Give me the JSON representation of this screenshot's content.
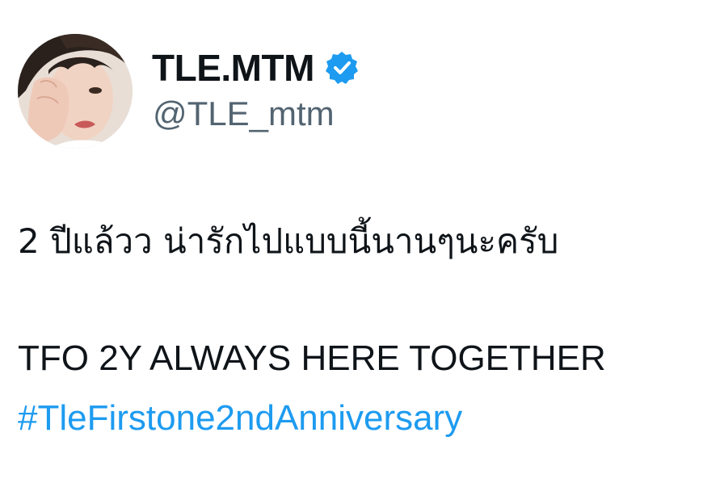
{
  "profile": {
    "display_name": "TLE.MTM",
    "handle": "@TLE_mtm",
    "verified_icon": "verified-badge-icon",
    "avatar_icon": "profile-photo"
  },
  "tweet": {
    "line1": "2 ปีแล้วว น่ารักไปแบบนี้นานๆนะครับ",
    "line2": "TFO 2Y ALWAYS HERE TOGETHER",
    "hashtag": "#TleFirstone2ndAnniversary"
  },
  "colors": {
    "text": "#0f1419",
    "handle": "#536471",
    "link": "#1d9bf0",
    "verified": "#1d9bf0"
  }
}
